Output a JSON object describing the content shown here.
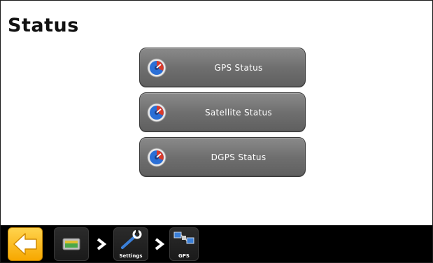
{
  "page": {
    "title": "Status"
  },
  "menu": {
    "items": [
      {
        "label": "GPS Status",
        "icon": "gauge-icon"
      },
      {
        "label": "Satellite Status",
        "icon": "gauge-icon"
      },
      {
        "label": "DGPS Status",
        "icon": "gauge-icon"
      }
    ]
  },
  "taskbar": {
    "back_icon": "back-arrow-icon",
    "display_icon": "display-icon",
    "settings_label": "Settings",
    "settings_icon": "wrench-icon",
    "gps_label": "GPS",
    "gps_icon": "satellite-icon"
  },
  "colors": {
    "button_gray": "#6f6f6f",
    "back_orange": "#f7a800",
    "taskbar_black": "#000000",
    "text_white": "#ffffff"
  }
}
